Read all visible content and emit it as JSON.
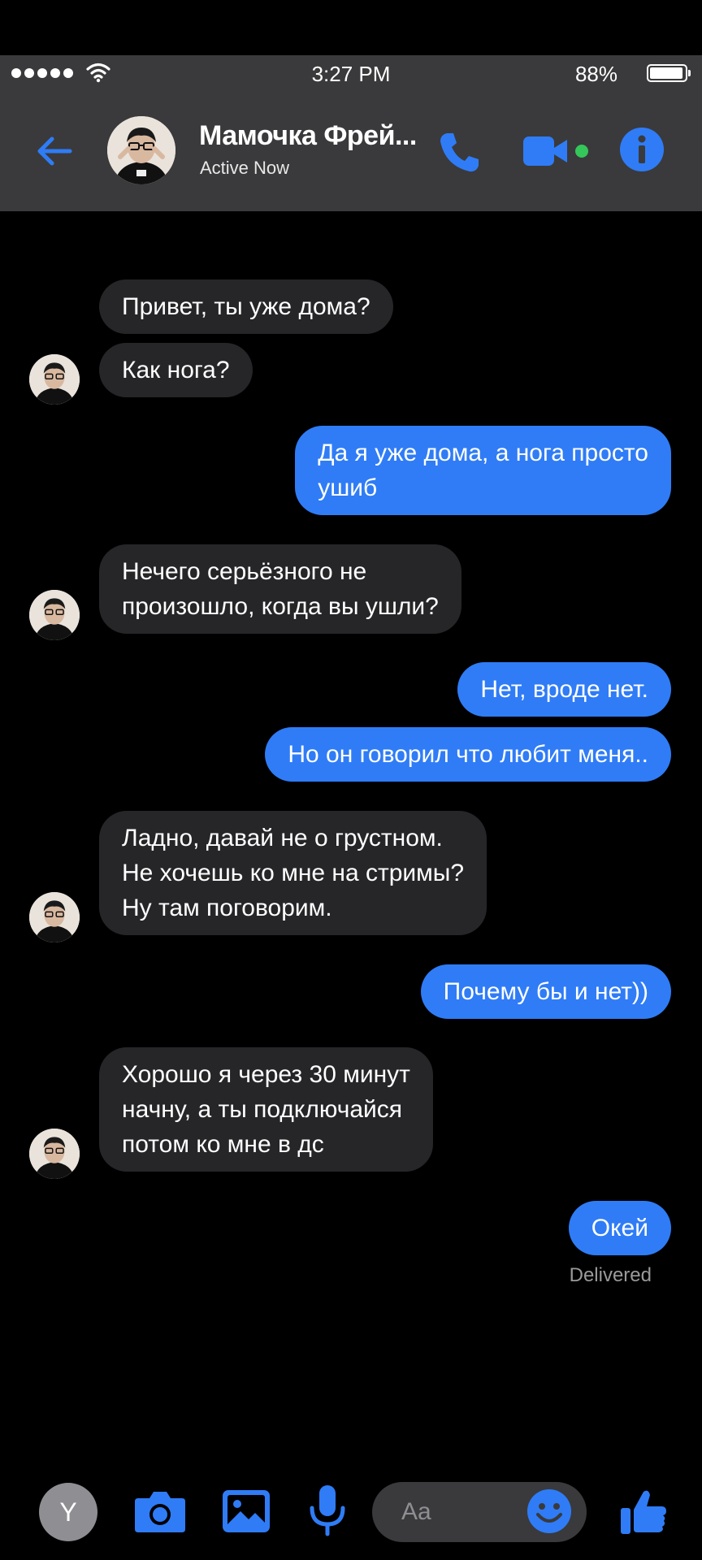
{
  "status_bar": {
    "time": "3:27 PM",
    "battery": "88%"
  },
  "header": {
    "contact_name": "Мамочка Фрей...",
    "contact_status": "Active Now"
  },
  "accent_color": "#2f7cf6",
  "messages": [
    {
      "from": "them",
      "text": "Привет, ты уже дома?"
    },
    {
      "from": "them",
      "text": "Как нога?"
    },
    {
      "from": "me",
      "lines": [
        "Да я уже дома, а нога просто",
        "ушиб"
      ]
    },
    {
      "from": "them",
      "lines": [
        "Нечего серьёзного не",
        "произошло, когда вы ушли?"
      ]
    },
    {
      "from": "me",
      "text": "Нет, вроде нет."
    },
    {
      "from": "me",
      "text": "Но он говорил что любит меня.."
    },
    {
      "from": "them",
      "lines": [
        "Ладно, давай не о грустном.",
        "Не хочешь ко мне на стримы?",
        "Ну там поговорим."
      ]
    },
    {
      "from": "me",
      "text": "Почему бы и нет))"
    },
    {
      "from": "them",
      "lines": [
        "Хорошо я через 30 минут",
        "начну, а ты подключайся",
        "потом ко мне в дс"
      ]
    },
    {
      "from": "me",
      "text": "Окей"
    }
  ],
  "delivery_status": "Delivered",
  "composer": {
    "avatar_letter": "Y",
    "placeholder": "Aa"
  },
  "icons": [
    "back-arrow-icon",
    "phone-icon",
    "video-icon",
    "info-icon",
    "camera-icon",
    "gallery-icon",
    "mic-icon",
    "emoji-icon",
    "thumbs-up-icon"
  ]
}
